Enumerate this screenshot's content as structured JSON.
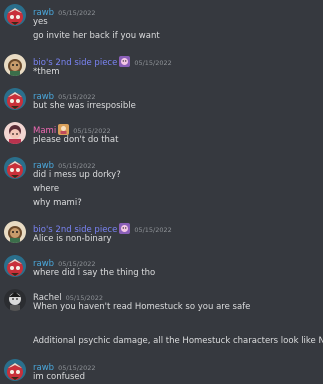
{
  "colors": {
    "background": "#36393f",
    "rawb_name": "#4aa8dc",
    "bio_name": "#7a84f5",
    "mami_name": "#f06ab4",
    "rachel_name": "#dcddde",
    "text": "#dcddde",
    "timestamp": "#8e9297"
  },
  "messages": [
    {
      "name": "rawb",
      "time": "05/15/2022",
      "avatar": "rawb-avatar-icon",
      "lines": [
        "yes",
        "go invite her back if you want"
      ]
    },
    {
      "name": "bio's 2nd side piece",
      "time": "05/15/2022",
      "avatar": "bio-avatar-icon",
      "badge": "role-emoji-icon",
      "lines": [
        "*them"
      ]
    },
    {
      "name": "rawb",
      "time": "05/15/2022",
      "avatar": "rawb-avatar-icon",
      "lines": [
        "but she was irresposible"
      ]
    },
    {
      "name": "Mami",
      "time": "05/15/2022",
      "avatar": "mami-avatar-icon",
      "badge": "role-emoji-icon",
      "lines": [
        "please don't do that"
      ]
    },
    {
      "name": "rawb",
      "time": "05/15/2022",
      "avatar": "rawb-avatar-icon",
      "lines": [
        "did i mess up dorky?",
        "where",
        "why mami?"
      ]
    },
    {
      "name": "bio's 2nd side piece",
      "time": "05/15/2022",
      "avatar": "bio-avatar-icon",
      "badge": "role-emoji-icon",
      "lines": [
        "Alice is non-binary"
      ]
    },
    {
      "name": "rawb",
      "time": "05/15/2022",
      "avatar": "rawb-avatar-icon",
      "lines": [
        "where did i say the thing tho"
      ]
    },
    {
      "name": "Rachel",
      "time": "05/15/2022",
      "avatar": "rachel-avatar-icon",
      "lines": [
        "When you haven't read Homestuck so you are safe",
        "",
        "Additional psychic damage, all the Homestuck characters look like NFTs"
      ]
    },
    {
      "name": "rawb",
      "time": "05/15/2022",
      "avatar": "rawb-avatar-icon",
      "lines": [
        "im confused"
      ]
    }
  ]
}
